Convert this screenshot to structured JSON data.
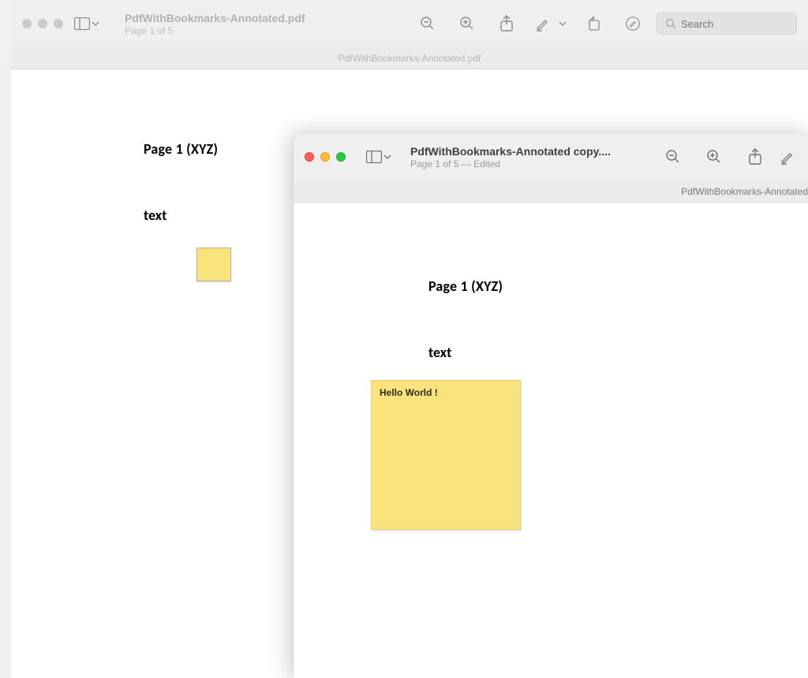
{
  "back_window": {
    "filename": "PdfWithBookmarks-Annotated.pdf",
    "page_status": "Page 1 of 5",
    "tab_label": "PdfWithBookmarks-Annotated.pdf",
    "search_placeholder": "Search",
    "doc": {
      "heading": "Page 1 (XYZ)",
      "body": "text"
    }
  },
  "front_window": {
    "filename": "PdfWithBookmarks-Annotated copy....",
    "page_status": "Page 1 of 5 — Edited",
    "tab_label": "PdfWithBookmarks-Annotated",
    "doc": {
      "heading": "Page 1 (XYZ)",
      "body": "text",
      "note_text": "Hello World !"
    }
  },
  "colors": {
    "sticky": "#f9e37c"
  }
}
